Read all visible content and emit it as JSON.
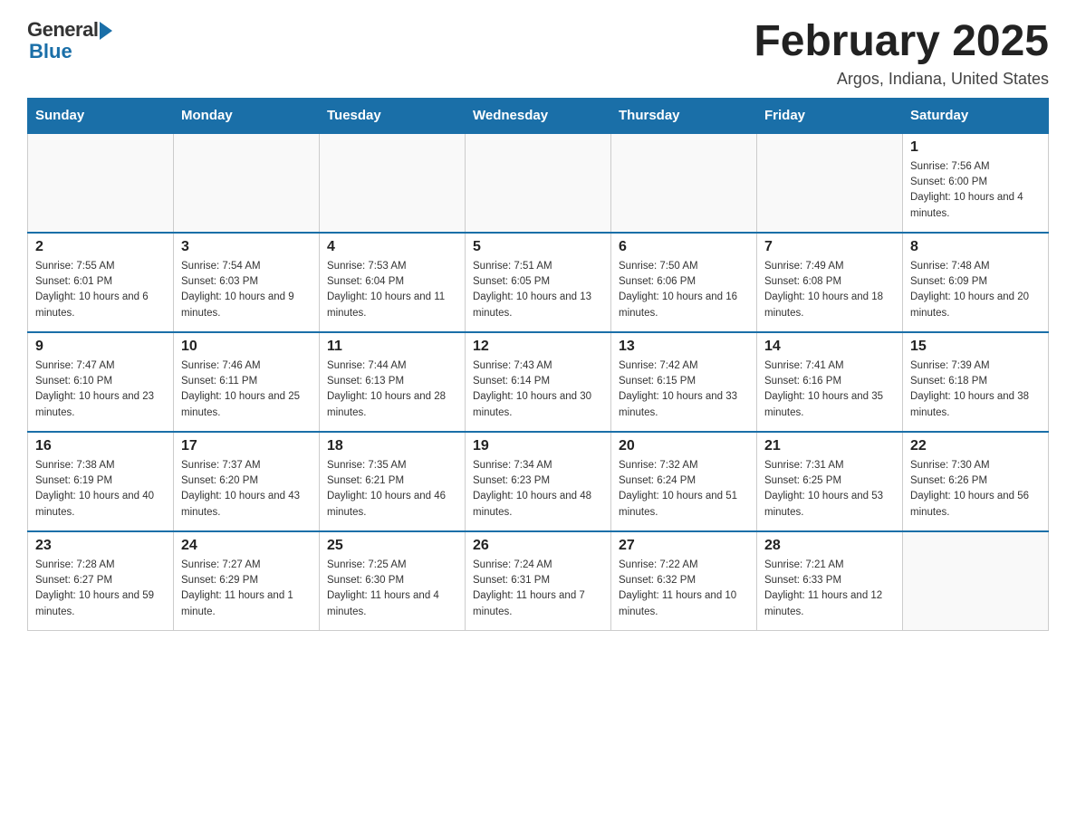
{
  "logo": {
    "general": "General",
    "blue": "Blue"
  },
  "title": "February 2025",
  "location": "Argos, Indiana, United States",
  "days_of_week": [
    "Sunday",
    "Monday",
    "Tuesday",
    "Wednesday",
    "Thursday",
    "Friday",
    "Saturday"
  ],
  "weeks": [
    [
      {
        "day": "",
        "info": ""
      },
      {
        "day": "",
        "info": ""
      },
      {
        "day": "",
        "info": ""
      },
      {
        "day": "",
        "info": ""
      },
      {
        "day": "",
        "info": ""
      },
      {
        "day": "",
        "info": ""
      },
      {
        "day": "1",
        "info": "Sunrise: 7:56 AM\nSunset: 6:00 PM\nDaylight: 10 hours and 4 minutes."
      }
    ],
    [
      {
        "day": "2",
        "info": "Sunrise: 7:55 AM\nSunset: 6:01 PM\nDaylight: 10 hours and 6 minutes."
      },
      {
        "day": "3",
        "info": "Sunrise: 7:54 AM\nSunset: 6:03 PM\nDaylight: 10 hours and 9 minutes."
      },
      {
        "day": "4",
        "info": "Sunrise: 7:53 AM\nSunset: 6:04 PM\nDaylight: 10 hours and 11 minutes."
      },
      {
        "day": "5",
        "info": "Sunrise: 7:51 AM\nSunset: 6:05 PM\nDaylight: 10 hours and 13 minutes."
      },
      {
        "day": "6",
        "info": "Sunrise: 7:50 AM\nSunset: 6:06 PM\nDaylight: 10 hours and 16 minutes."
      },
      {
        "day": "7",
        "info": "Sunrise: 7:49 AM\nSunset: 6:08 PM\nDaylight: 10 hours and 18 minutes."
      },
      {
        "day": "8",
        "info": "Sunrise: 7:48 AM\nSunset: 6:09 PM\nDaylight: 10 hours and 20 minutes."
      }
    ],
    [
      {
        "day": "9",
        "info": "Sunrise: 7:47 AM\nSunset: 6:10 PM\nDaylight: 10 hours and 23 minutes."
      },
      {
        "day": "10",
        "info": "Sunrise: 7:46 AM\nSunset: 6:11 PM\nDaylight: 10 hours and 25 minutes."
      },
      {
        "day": "11",
        "info": "Sunrise: 7:44 AM\nSunset: 6:13 PM\nDaylight: 10 hours and 28 minutes."
      },
      {
        "day": "12",
        "info": "Sunrise: 7:43 AM\nSunset: 6:14 PM\nDaylight: 10 hours and 30 minutes."
      },
      {
        "day": "13",
        "info": "Sunrise: 7:42 AM\nSunset: 6:15 PM\nDaylight: 10 hours and 33 minutes."
      },
      {
        "day": "14",
        "info": "Sunrise: 7:41 AM\nSunset: 6:16 PM\nDaylight: 10 hours and 35 minutes."
      },
      {
        "day": "15",
        "info": "Sunrise: 7:39 AM\nSunset: 6:18 PM\nDaylight: 10 hours and 38 minutes."
      }
    ],
    [
      {
        "day": "16",
        "info": "Sunrise: 7:38 AM\nSunset: 6:19 PM\nDaylight: 10 hours and 40 minutes."
      },
      {
        "day": "17",
        "info": "Sunrise: 7:37 AM\nSunset: 6:20 PM\nDaylight: 10 hours and 43 minutes."
      },
      {
        "day": "18",
        "info": "Sunrise: 7:35 AM\nSunset: 6:21 PM\nDaylight: 10 hours and 46 minutes."
      },
      {
        "day": "19",
        "info": "Sunrise: 7:34 AM\nSunset: 6:23 PM\nDaylight: 10 hours and 48 minutes."
      },
      {
        "day": "20",
        "info": "Sunrise: 7:32 AM\nSunset: 6:24 PM\nDaylight: 10 hours and 51 minutes."
      },
      {
        "day": "21",
        "info": "Sunrise: 7:31 AM\nSunset: 6:25 PM\nDaylight: 10 hours and 53 minutes."
      },
      {
        "day": "22",
        "info": "Sunrise: 7:30 AM\nSunset: 6:26 PM\nDaylight: 10 hours and 56 minutes."
      }
    ],
    [
      {
        "day": "23",
        "info": "Sunrise: 7:28 AM\nSunset: 6:27 PM\nDaylight: 10 hours and 59 minutes."
      },
      {
        "day": "24",
        "info": "Sunrise: 7:27 AM\nSunset: 6:29 PM\nDaylight: 11 hours and 1 minute."
      },
      {
        "day": "25",
        "info": "Sunrise: 7:25 AM\nSunset: 6:30 PM\nDaylight: 11 hours and 4 minutes."
      },
      {
        "day": "26",
        "info": "Sunrise: 7:24 AM\nSunset: 6:31 PM\nDaylight: 11 hours and 7 minutes."
      },
      {
        "day": "27",
        "info": "Sunrise: 7:22 AM\nSunset: 6:32 PM\nDaylight: 11 hours and 10 minutes."
      },
      {
        "day": "28",
        "info": "Sunrise: 7:21 AM\nSunset: 6:33 PM\nDaylight: 11 hours and 12 minutes."
      },
      {
        "day": "",
        "info": ""
      }
    ]
  ]
}
